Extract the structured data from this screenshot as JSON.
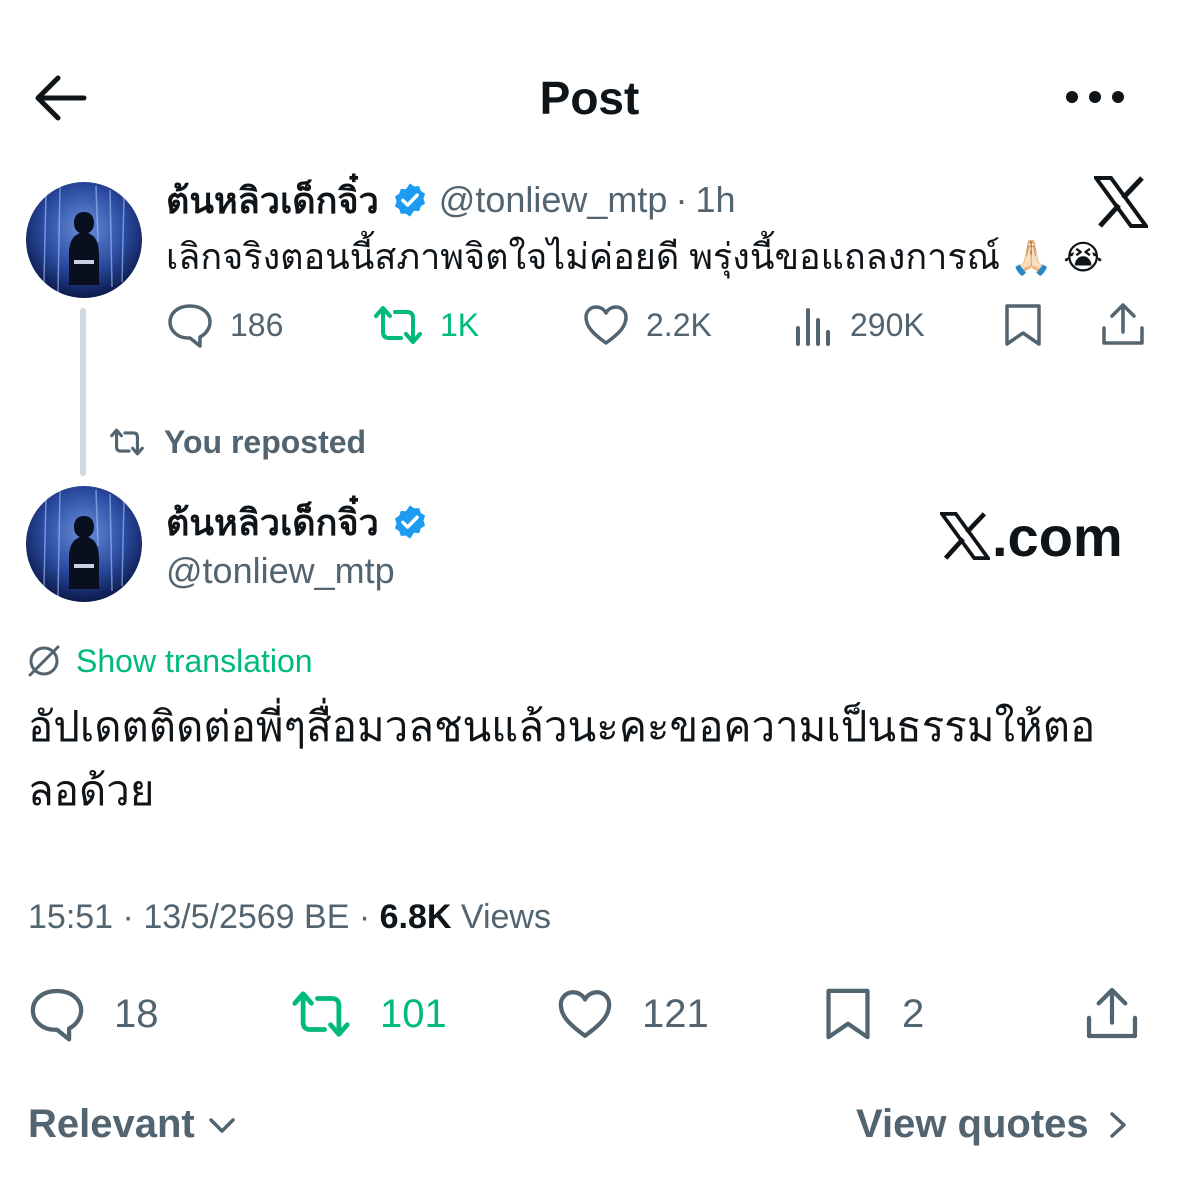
{
  "header": {
    "title": "Post"
  },
  "quoted_post": {
    "display_name": "ต้นหลิวเด็กจิ๋ว",
    "handle": "@tonliew_mtp",
    "separator": "·",
    "time": "1h",
    "text": "เลิกจริงตอนนี้สภาพจิตใจไม่ค่อยดี พรุ่งนี้ขอแถลงการณ์",
    "emojis": "🙏🏻 😭",
    "stats": {
      "replies": "186",
      "reposts": "1K",
      "likes": "2.2K",
      "views": "290K"
    }
  },
  "repost_label": "You reposted",
  "post": {
    "display_name": "ต้นหลิวเด็กจิ๋ว",
    "handle": "@tonliew_mtp",
    "watermark": ".com",
    "translation_link": "Show translation",
    "text": "อัปเดตติดต่อพี่ๆสื่อมวลชนแล้วนะคะขอความเป็นธรรมให้ตอลอด้วย",
    "time": "15:51",
    "date": "13/5/2569 BE",
    "dot": "·",
    "views_count": "6.8K",
    "views_label": "Views",
    "stats": {
      "replies": "18",
      "reposts": "101",
      "likes": "121",
      "bookmarks": "2"
    }
  },
  "footer": {
    "sort_label": "Relevant",
    "quotes_label": "View quotes"
  },
  "colors": {
    "verified": "#1d9bf0",
    "repost_green": "#00ba7c",
    "secondary": "#536471",
    "thread_line": "#cfd9de"
  }
}
